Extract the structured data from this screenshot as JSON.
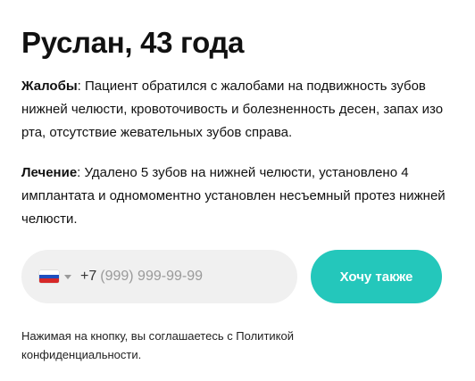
{
  "title": "Руслан, 43 года",
  "complaints": {
    "label": "Жалобы",
    "text": ": Пациент обратился с жалобами на подвижность зубов нижней челюсти, кровоточивость и болезненность десен, запах изо рта, отсутствие жевательных зубов справа."
  },
  "treatment": {
    "label": "Лечение",
    "text": ": Удалено 5 зубов на нижней челюсти, установлено 4 имплантата и одномоментно установлен несъемный протез нижней челюсти."
  },
  "phone": {
    "flag_icon": "russia-flag-icon",
    "country_code": "+7",
    "placeholder": "(999) 999-99-99",
    "value": ""
  },
  "cta": {
    "label": "Хочу также",
    "color": "#24c7bb"
  },
  "consent": "Нажимая на кнопку, вы соглашаетесь с Политикой конфиденциальности."
}
